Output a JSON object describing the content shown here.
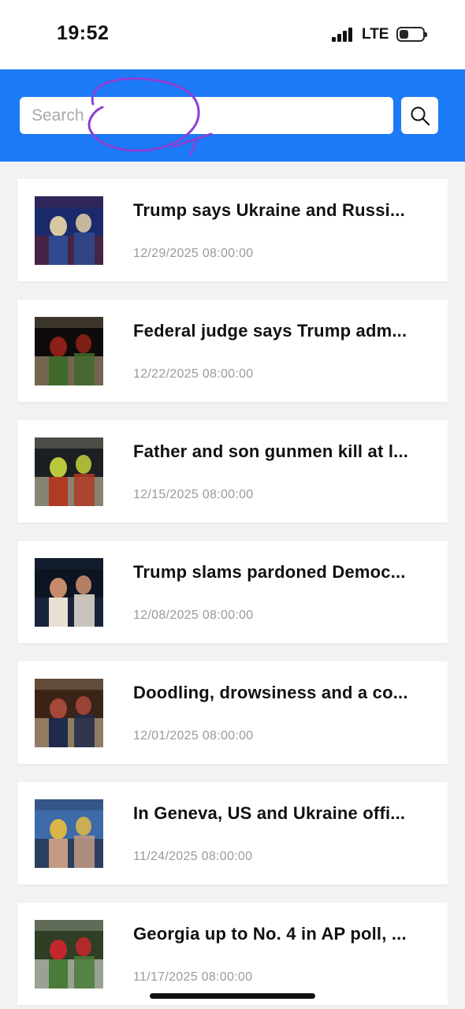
{
  "status_bar": {
    "time": "19:52",
    "network": "LTE",
    "signal_icon": "cellular-signal-icon",
    "battery_icon": "battery-icon"
  },
  "header": {
    "background_color": "#1d7af6",
    "search": {
      "placeholder": "Search",
      "value": "",
      "button_icon": "search-icon"
    }
  },
  "news": [
    {
      "title": "Trump says Ukraine and Russi...",
      "date": "12/29/2025 08:00:00",
      "thumbnail": "image-flags-two-men-handshake",
      "palette": [
        "#1b2a6b",
        "#d7c7a3",
        "#6a1f25",
        "#2f4a8f"
      ]
    },
    {
      "title": "Federal judge says Trump adm...",
      "date": "12/22/2025 08:00:00",
      "thumbnail": "image-memorial-flowers-candles",
      "palette": [
        "#0e0b0a",
        "#8c1f18",
        "#c9b28a",
        "#3f6a2a"
      ]
    },
    {
      "title": "Father and son gunmen kill at l...",
      "date": "12/15/2025 08:00:00",
      "thumbnail": "image-emergency-responders-night",
      "palette": [
        "#1c1f22",
        "#b9c93b",
        "#e0d7b8",
        "#b13a24"
      ]
    },
    {
      "title": "Trump slams pardoned Democ...",
      "date": "12/08/2025 08:00:00",
      "thumbnail": "image-man-portrait-speaking",
      "palette": [
        "#0d1422",
        "#c68b6c",
        "#20324f",
        "#e8e0d3"
      ]
    },
    {
      "title": "Doodling, drowsiness and a co...",
      "date": "12/01/2025 08:00:00",
      "thumbnail": "image-cabinet-meeting-room",
      "palette": [
        "#3b2417",
        "#a4483a",
        "#d9c5a1",
        "#1e2a4a"
      ]
    },
    {
      "title": "In Geneva, US and Ukraine offi...",
      "date": "11/24/2025 08:00:00",
      "thumbnail": "image-officials-press-event",
      "palette": [
        "#3d6ba9",
        "#d9b54a",
        "#1c1c22",
        "#c49b82"
      ]
    },
    {
      "title": "Georgia up to No. 4 in AP poll, ...",
      "date": "11/17/2025 08:00:00",
      "thumbnail": "image-football-players-field",
      "palette": [
        "#2f3e24",
        "#c1272d",
        "#f2f2f2",
        "#4a7b39"
      ]
    }
  ]
}
